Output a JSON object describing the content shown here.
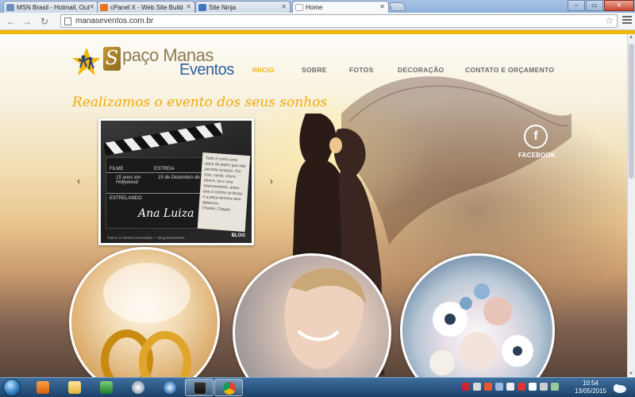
{
  "browser": {
    "tabs": [
      {
        "title": "MSN Brasil - Hotmail, Out",
        "favicon_color": "#6e8fb8"
      },
      {
        "title": "cPanel X - Web Site Build",
        "favicon_color": "#e8741c"
      },
      {
        "title": "Site Ninja",
        "favicon_color": "#3d77c2"
      },
      {
        "title": "Home",
        "favicon_color": "#ffffff",
        "active": true
      }
    ],
    "url": "manaseventos.com.br"
  },
  "site": {
    "logo": {
      "brand_line1": "paço Manas",
      "brand_initial": "S",
      "brand_line2": "Eventos"
    },
    "nav": [
      "INICIO",
      "SOBRE",
      "FOTOS",
      "DECORAÇÃO",
      "CONTATO E ORÇAMENTO"
    ],
    "headline": "Realizamos o evento dos seus sonhos",
    "slide": {
      "labels": {
        "filme": "FILME",
        "estreia": "ESTREIA",
        "estrelando": "ESTRELANDO"
      },
      "film_text": "15 anos em Hollywood",
      "date_text": "15 de Dezembro de 2009",
      "star_name": "Ana Luiza",
      "note_text": "Tudo é como uma peça de teatro que não permite ensaios. Por isso, cante, chore, dance, ria e viva intensamente, antes que a cortina se feche e a peça termine sem aplausos.",
      "note_author": "Charles Chaplin",
      "caption": "Todos os direitos reservados — Blog Debutantes",
      "blog_label": "BLOG"
    },
    "social": {
      "label": "FACEBOOK",
      "icon": "facebook-icon"
    },
    "accent_color": "#f2b705"
  },
  "taskbar": {
    "time": "10:54",
    "date": "13/05/2015",
    "apps": [
      "media-player-icon",
      "folder-icon",
      "excel-icon",
      "firefox-icon",
      "gallery-icon",
      "chrome-icon"
    ]
  }
}
